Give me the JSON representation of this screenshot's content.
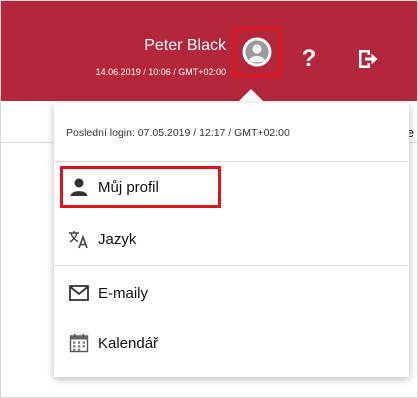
{
  "header": {
    "user_name": "Peter Black",
    "user_datetime": "14.06.2019 / 10:06 / GMT+02:00",
    "avatar_icon": "user-avatar-icon",
    "help_label": "?",
    "logout_icon": "logout-icon",
    "bar_color": "#b3263c",
    "highlight_color": "#e0151c"
  },
  "background": {
    "partial_text": "ace"
  },
  "dropdown": {
    "last_login": "Poslední login: 07.05.2019 / 12:17 / GMT+02:00",
    "items": [
      {
        "label": "Můj profil",
        "icon": "user-icon"
      },
      {
        "label": "Jazyk",
        "icon": "translate-icon"
      },
      {
        "label": "E-maily",
        "icon": "envelope-icon"
      },
      {
        "label": "Kalendář",
        "icon": "calendar-icon"
      }
    ]
  }
}
